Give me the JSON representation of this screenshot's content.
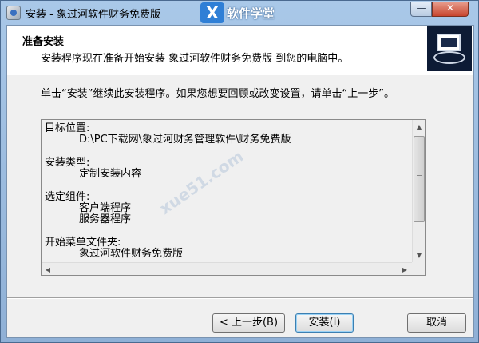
{
  "window": {
    "title": "安装 - 象过河软件财务免费版",
    "minimize_glyph": "—",
    "close_glyph": "✕"
  },
  "watermark": {
    "logo_glyph": "X",
    "text": "软件学堂",
    "url": "xue51.com"
  },
  "header": {
    "title": "准备安装",
    "subtitle": "安装程序现在准备开始安装 象过河软件财务免费版 到您的电脑中。"
  },
  "body": {
    "intro": "单击“安装”继续此安装程序。如果您想要回顾或改变设置，请单击“上一步”。"
  },
  "memo": {
    "groups": [
      {
        "label": "目标位置:",
        "values": [
          "D:\\PC下载网\\象过河财务管理软件\\财务免费版"
        ]
      },
      {
        "label": "安装类型:",
        "values": [
          "定制安装内容"
        ]
      },
      {
        "label": "选定组件:",
        "values": [
          "客户端程序",
          "服务器程序"
        ]
      },
      {
        "label": "开始菜单文件夹:",
        "values": [
          "象过河软件财务免费版"
        ]
      }
    ]
  },
  "buttons": {
    "back": "< 上一步(B)",
    "install": "安装(I)",
    "cancel": "取消"
  },
  "colors": {
    "accent": "#3c7fb1",
    "close": "#c8452e"
  }
}
